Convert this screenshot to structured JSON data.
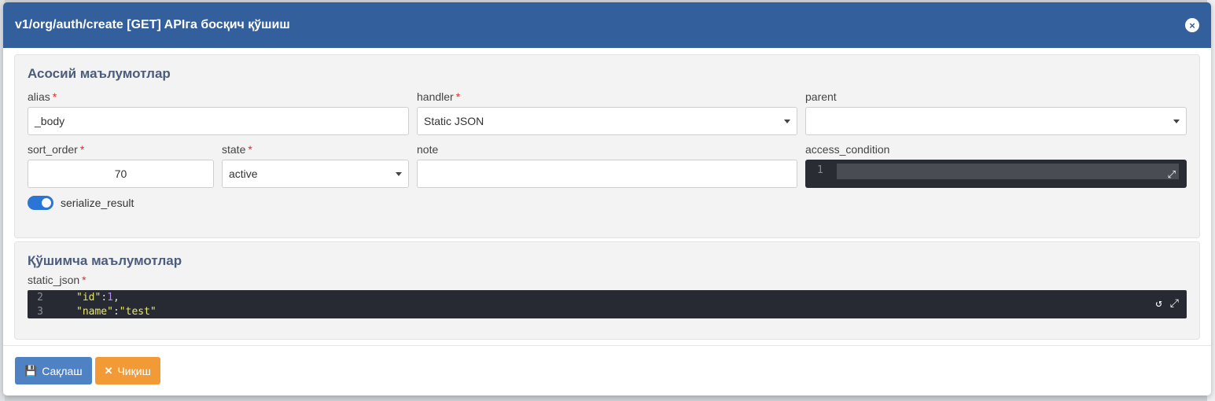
{
  "modal": {
    "title": "v1/org/auth/create [GET] APIга босқич қўшиш",
    "close_icon": "×"
  },
  "main_panel": {
    "title": "Асосий маълумотлар",
    "alias": {
      "label": "alias",
      "value": "_body"
    },
    "handler": {
      "label": "handler",
      "value": "Static JSON"
    },
    "parent": {
      "label": "parent",
      "value": ""
    },
    "sort_order": {
      "label": "sort_order",
      "value": "70"
    },
    "state": {
      "label": "state",
      "value": "active"
    },
    "note": {
      "label": "note",
      "value": ""
    },
    "access_condition": {
      "label": "access_condition",
      "line_number": "1"
    },
    "serialize_result": {
      "label": "serialize_result",
      "enabled": true
    },
    "required_mark": "*"
  },
  "extra_panel": {
    "title": "Қўшимча маълумотлар",
    "static_json": {
      "label": "static_json",
      "lines": [
        {
          "num": "2",
          "key": "\"id\"",
          "sep": ":",
          "value": "1",
          "tail": ","
        },
        {
          "num": "3",
          "key": "\"name\"",
          "sep": ":",
          "value": "\"test\"",
          "tail": ""
        }
      ]
    }
  },
  "footer": {
    "save_label": "Сақлаш",
    "exit_label": "Чиқиш"
  },
  "colors": {
    "header": "#335f9c",
    "save": "#4f82c5",
    "exit": "#f29b36",
    "toggle": "#2b75d6"
  }
}
